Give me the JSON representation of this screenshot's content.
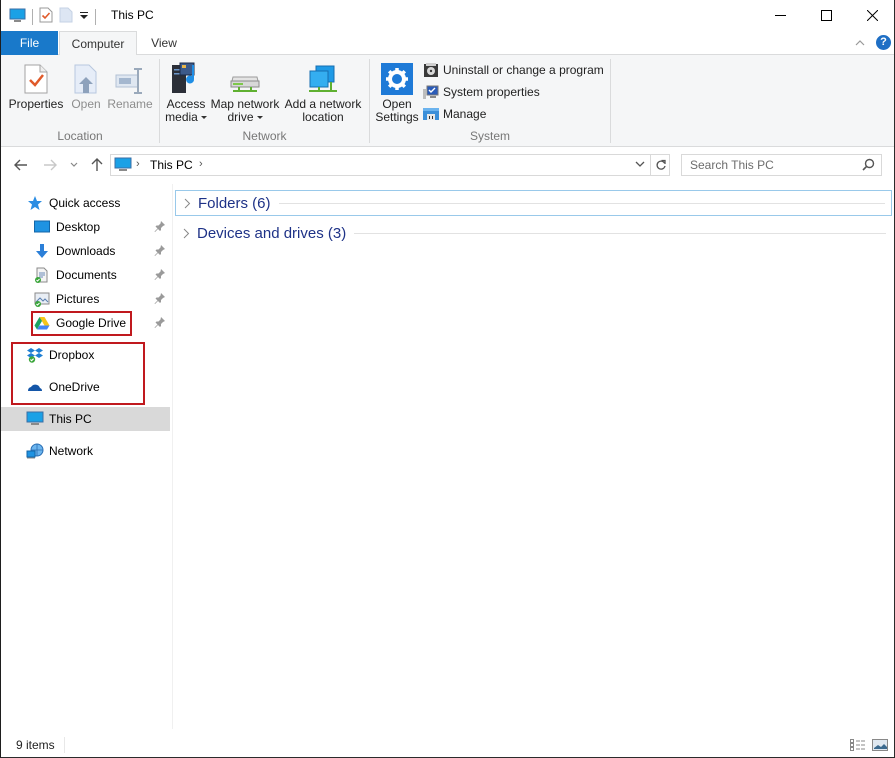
{
  "window": {
    "title": "This PC",
    "controls": {
      "minimize": "minimize",
      "maximize": "maximize",
      "close": "close"
    }
  },
  "quick_access_toolbar": {
    "icons": [
      "this-pc-icon",
      "properties-icon",
      "new-folder-icon",
      "customize-dropdown-icon"
    ]
  },
  "ribbon": {
    "tabs": [
      {
        "label": "File",
        "active": false
      },
      {
        "label": "Computer",
        "active": true
      },
      {
        "label": "View",
        "active": false
      }
    ],
    "groups": {
      "location": {
        "label": "Location",
        "buttons": [
          {
            "label": "Properties",
            "enabled": true
          },
          {
            "label": "Open",
            "enabled": false
          },
          {
            "label": "Rename",
            "enabled": false
          }
        ]
      },
      "network": {
        "label": "Network",
        "buttons": [
          {
            "line1": "Access",
            "line2": "media",
            "dropdown": true
          },
          {
            "line1": "Map network",
            "line2": "drive",
            "dropdown": true
          },
          {
            "line1": "Add a network",
            "line2": "location",
            "dropdown": false
          }
        ]
      },
      "system": {
        "label": "System",
        "open_settings": {
          "line1": "Open",
          "line2": "Settings"
        },
        "small_buttons": [
          {
            "label": "Uninstall or change a program"
          },
          {
            "label": "System properties"
          },
          {
            "label": "Manage"
          }
        ]
      }
    },
    "help": "?"
  },
  "address_bar": {
    "breadcrumb": [
      "This PC"
    ],
    "search_placeholder": "Search This PC"
  },
  "nav_pane": {
    "items": [
      {
        "label": "Quick access",
        "icon": "star-icon",
        "pinned": false,
        "level": 0
      },
      {
        "label": "Desktop",
        "icon": "desktop-icon",
        "pinned": true,
        "level": 1
      },
      {
        "label": "Downloads",
        "icon": "downloads-icon",
        "pinned": true,
        "level": 1
      },
      {
        "label": "Documents",
        "icon": "documents-icon",
        "pinned": true,
        "level": 1
      },
      {
        "label": "Pictures",
        "icon": "pictures-icon",
        "pinned": true,
        "level": 1
      },
      {
        "label": "Google Drive",
        "icon": "google-drive-icon",
        "pinned": true,
        "level": 1,
        "highlighted": true
      },
      {
        "label": "Dropbox",
        "icon": "dropbox-icon",
        "pinned": false,
        "level": 0,
        "highlighted": true
      },
      {
        "label": "OneDrive",
        "icon": "onedrive-icon",
        "pinned": false,
        "level": 0,
        "highlighted": true
      },
      {
        "label": "This PC",
        "icon": "this-pc-icon",
        "pinned": false,
        "level": 0,
        "selected": true
      },
      {
        "label": "Network",
        "icon": "network-icon",
        "pinned": false,
        "level": 0
      }
    ]
  },
  "content": {
    "groups": [
      {
        "label": "Folders (6)",
        "collapsed": true,
        "focused": true
      },
      {
        "label": "Devices and drives (3)",
        "collapsed": true,
        "focused": false
      }
    ]
  },
  "status_bar": {
    "item_count": "9 items",
    "views": [
      "details-view",
      "large-icons-view"
    ]
  },
  "colors": {
    "accent": "#1979ca",
    "group_header_text": "#1e3287",
    "highlight_box": "#c0191e",
    "selected_bg": "#d9d9d9",
    "ribbon_bg": "#f5f6f7"
  }
}
